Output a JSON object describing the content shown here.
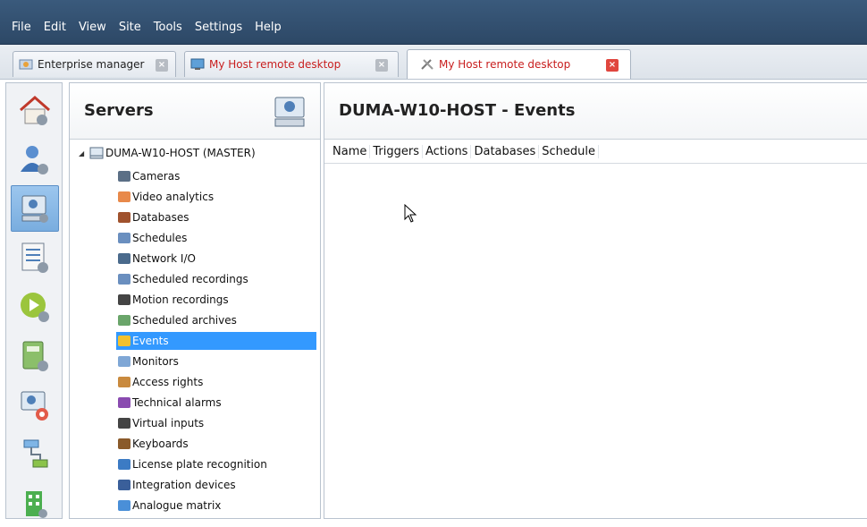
{
  "menu": [
    "File",
    "Edit",
    "View",
    "Site",
    "Tools",
    "Settings",
    "Help"
  ],
  "tabs": [
    {
      "label": "Enterprise manager",
      "color": "#222222"
    },
    {
      "label": "My Host remote desktop",
      "color": "#c81e1e"
    },
    {
      "label": "My Host remote desktop",
      "color": "#c81e1e"
    }
  ],
  "rail": {
    "items": [
      "home-settings",
      "user-settings",
      "server-settings",
      "list-settings",
      "play-settings",
      "book-settings",
      "monitor-settings",
      "network-settings",
      "building-settings"
    ],
    "selected": 2
  },
  "servers": {
    "title": "Servers",
    "root_label": "DUMA-W10-HOST (MASTER)",
    "items": [
      "Cameras",
      "Video analytics",
      "Databases",
      "Schedules",
      "Network I/O",
      "Scheduled recordings",
      "Motion recordings",
      "Scheduled archives",
      "Events",
      "Monitors",
      "Access rights",
      "Technical alarms",
      "Virtual inputs",
      "Keyboards",
      "License plate recognition",
      "Integration devices",
      "Analogue matrix"
    ],
    "selected": "Events"
  },
  "events": {
    "title": "DUMA-W10-HOST - Events",
    "columns": [
      "Name",
      "Triggers",
      "Actions",
      "Databases",
      "Schedule"
    ]
  }
}
